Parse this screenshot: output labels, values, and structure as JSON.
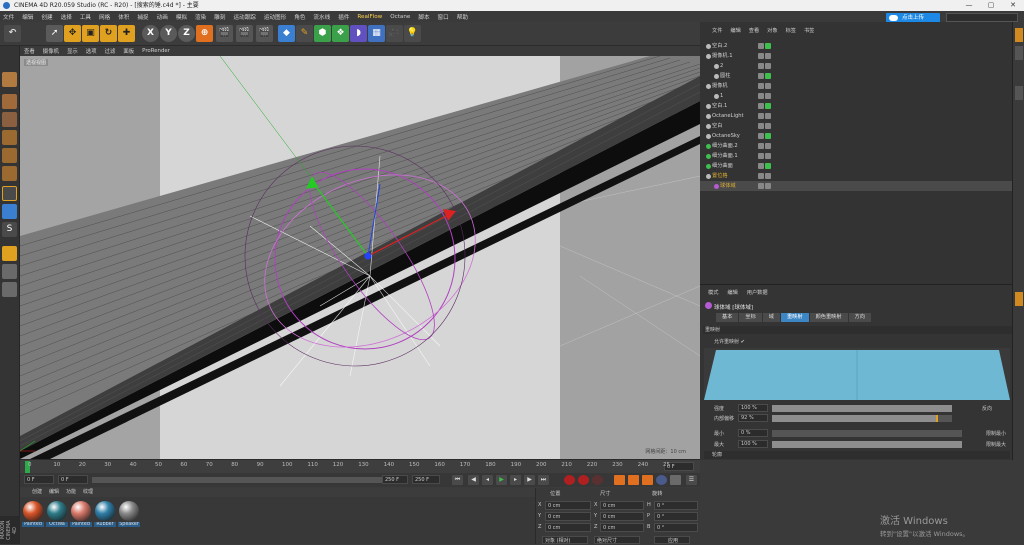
{
  "window": {
    "title": "CINEMA 4D R20.059 Studio (RC - R20) - [搜索的锤.c4d *] - 主要",
    "controls": [
      "—",
      "▢",
      "✕"
    ]
  },
  "menubar": {
    "items": [
      "文件",
      "编辑",
      "创建",
      "选择",
      "工具",
      "网格",
      "体积",
      "捕捉",
      "动画",
      "模拟",
      "渲染",
      "雕刻",
      "运动跟踪",
      "运动图形",
      "角色",
      "流水线",
      "插件",
      "RealFlow",
      "Octane",
      "脚本",
      "窗口",
      "帮助"
    ],
    "highlighted": "RealFlow"
  },
  "upload_button": {
    "label": "点击上传"
  },
  "toolbar": {
    "axis_x": "X",
    "axis_y": "Y",
    "axis_z": "Z"
  },
  "viewport": {
    "menu": [
      "查看",
      "摄像机",
      "显示",
      "选项",
      "过滤",
      "面板",
      "ProRender"
    ],
    "label": "透视视图",
    "scale_text": "网格间距：10 cm"
  },
  "timeline": {
    "ticks": [
      "0",
      "10",
      "20",
      "30",
      "40",
      "50",
      "60",
      "70",
      "80",
      "90",
      "100",
      "110",
      "120",
      "130",
      "140",
      "150",
      "160",
      "170",
      "180",
      "190",
      "200",
      "210",
      "220",
      "230",
      "240",
      "25"
    ],
    "end_frame_field": "0 F"
  },
  "transport": {
    "current_frame": "0 F",
    "min_frame": "0 F",
    "max_frame": "250 F",
    "end_frame": "250 F"
  },
  "materials": {
    "menu": [
      "创建",
      "编辑",
      "功能",
      "纹理"
    ],
    "items": [
      {
        "name": "Painted",
        "color": "#d9552a"
      },
      {
        "name": "OctWa",
        "color": "#2e7c8a"
      },
      {
        "name": "Painted",
        "color": "#d97a6b"
      },
      {
        "name": "Rubber",
        "color": "#2f7fa8"
      },
      {
        "name": "Speaker",
        "color": "#8a8a8a"
      }
    ]
  },
  "coordinates": {
    "headers": [
      "位置",
      "尺寸",
      "旋转"
    ],
    "rows": [
      {
        "axis": "X",
        "pos": "0 cm",
        "size_axis": "X",
        "size": "0 cm",
        "rot_axis": "H",
        "rot": "0 °"
      },
      {
        "axis": "Y",
        "pos": "0 cm",
        "size_axis": "Y",
        "size": "0 cm",
        "rot_axis": "P",
        "rot": "0 °"
      },
      {
        "axis": "Z",
        "pos": "0 cm",
        "size_axis": "Z",
        "size": "0 cm",
        "rot_axis": "B",
        "rot": "0 °"
      }
    ],
    "mode": "对象 (相对)",
    "size_mode": "绝对尺寸",
    "apply": "应用"
  },
  "objects": {
    "tabs": [
      "文件",
      "编辑",
      "查看",
      "对象",
      "标签",
      "书签"
    ],
    "rows": [
      {
        "name": "空白.2",
        "color": "#d0d0d0"
      },
      {
        "name": "摄像机.1",
        "color": "#d0d0d0"
      },
      {
        "name": "2",
        "color": "#d0d0d0"
      },
      {
        "name": "圆柱",
        "color": "#d0d0d0"
      },
      {
        "name": "摄像机",
        "color": "#d0d0d0"
      },
      {
        "name": "1",
        "color": "#d0d0d0"
      },
      {
        "name": "空白.1",
        "color": "#d0d0d0"
      },
      {
        "name": "OctaneLight",
        "color": "#d0d0d0"
      },
      {
        "name": "空白",
        "color": "#d0d0d0"
      },
      {
        "name": "OctaneSky",
        "color": "#d0d0d0"
      },
      {
        "name": "细分曲面.2",
        "color": "#d0d0d0"
      },
      {
        "name": "细分曲面.1",
        "color": "#d0d0d0"
      },
      {
        "name": "细分曲面",
        "color": "#d0d0d0"
      },
      {
        "name": "置位格",
        "color": "#e0b030"
      },
      {
        "name": "球体域",
        "color": "#e0b030"
      }
    ]
  },
  "attributes": {
    "tabs": [
      "模式",
      "编辑",
      "用户数据"
    ],
    "title": "球体域 [球体域]",
    "subtabs": [
      "基本",
      "坐标",
      "域",
      "重映射",
      "颜色重映射",
      "方向"
    ],
    "active_subtab": "重映射",
    "section": "重映射",
    "enable_label": "允许重映射",
    "fields": [
      {
        "label": "强度",
        "value": "100 %",
        "percent": 1.0
      },
      {
        "label": "内部偏移",
        "value": "92 %",
        "percent": 0.92
      },
      {
        "label": "最小",
        "value": "0 %",
        "percent": 0.0
      },
      {
        "label": "最大",
        "value": "100 %",
        "percent": 1.0
      }
    ],
    "invert_label": "反向",
    "clamp_min_label": "限制最小",
    "clamp_max_label": "限制最大",
    "outline_label": "轮廓"
  },
  "watermark": {
    "line1": "激活 Windows",
    "line2": "转到\"设置\"以激活 Windows。"
  },
  "maxon": "MAXON CINEMA 4D"
}
